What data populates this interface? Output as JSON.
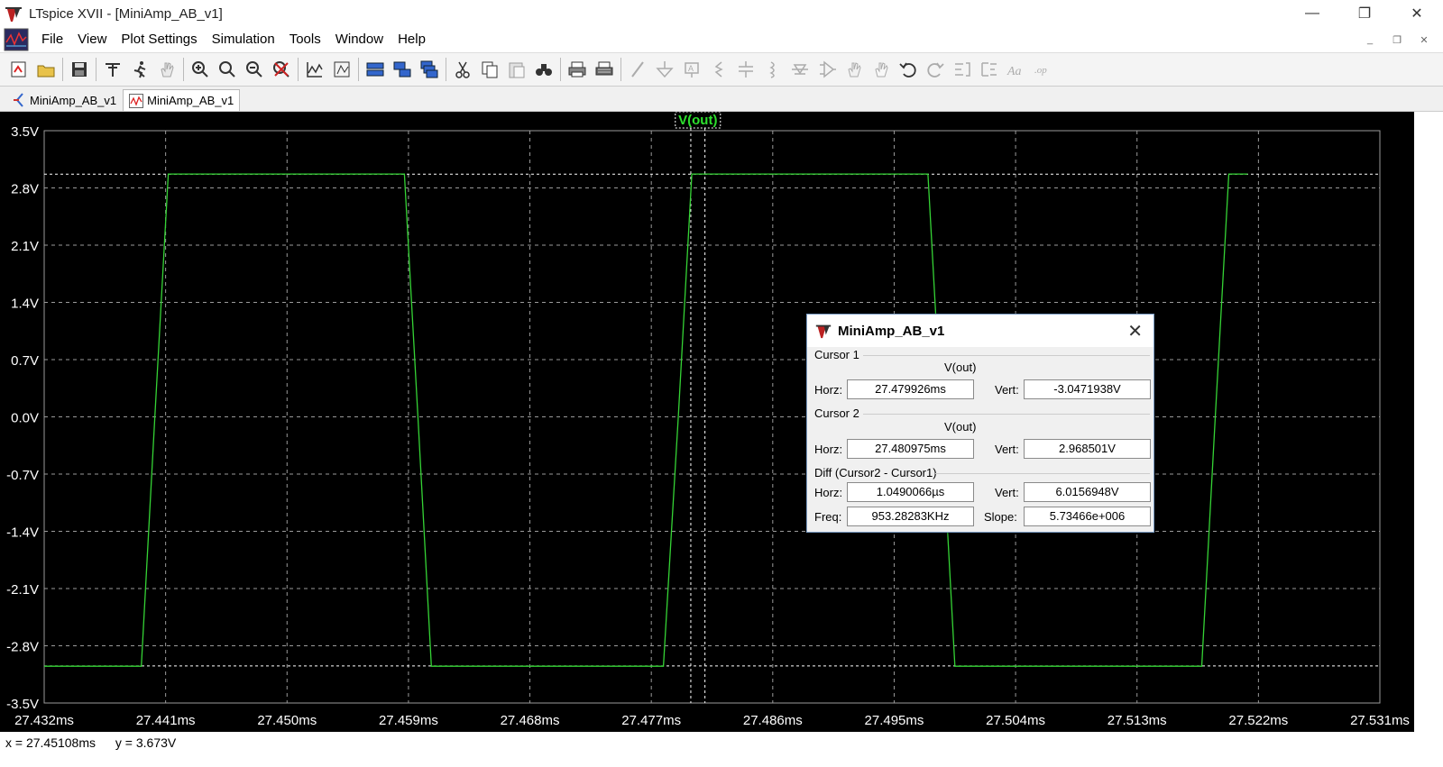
{
  "window": {
    "title": "LTspice XVII - [MiniAmp_AB_v1]",
    "controls": {
      "minimize": "—",
      "restore": "❐",
      "close": "✕"
    }
  },
  "menu": {
    "items": [
      "File",
      "View",
      "Plot Settings",
      "Simulation",
      "Tools",
      "Window",
      "Help"
    ],
    "mdi": {
      "minimize": "_",
      "restore": "❐",
      "close": "✕"
    }
  },
  "toolbar": {
    "icons": [
      "new-schematic-icon",
      "open-icon",
      "save-icon",
      "control-panel-icon",
      "run-icon",
      "pan-icon",
      "zoom-in-icon",
      "zoom-area-icon",
      "zoom-out-icon",
      "zoom-cancel-icon",
      "autorange-icon",
      "mark-unused-icon",
      "tile-vertical-icon",
      "tile-horizontal-icon",
      "cascade-icon",
      "cut-icon",
      "copy-icon",
      "paste-icon",
      "find-icon",
      "print-icon",
      "print-setup-icon",
      "wire-icon",
      "ground-icon",
      "label-icon",
      "resistor-icon",
      "capacitor-icon",
      "inductor-icon",
      "diode-icon",
      "component-icon",
      "move-icon",
      "drag-icon",
      "undo-icon",
      "redo-icon",
      "rotate-icon",
      "mirror-icon",
      "text-icon",
      "spice-directive-icon"
    ]
  },
  "tabs": [
    {
      "label": "MiniAmp_AB_v1",
      "icon": "schematic-icon",
      "active": false
    },
    {
      "label": "MiniAmp_AB_v1",
      "icon": "waveform-icon",
      "active": true
    }
  ],
  "colors": {
    "trace": "#35d335",
    "grid": "#9a9a9a",
    "background": "#000000",
    "axis_text": "#ffffff",
    "trace_label": "#2ee02e"
  },
  "chart_data": {
    "type": "line",
    "title": "",
    "series": [
      {
        "name": "V(out)",
        "x_ms": [
          27.432,
          27.4392,
          27.4402,
          27.4412,
          27.4432,
          27.4587,
          27.4597,
          27.4607,
          27.4627,
          27.4779,
          27.479,
          27.48,
          27.482,
          27.4975,
          27.4985,
          27.4995,
          27.5015,
          27.5178,
          27.5188,
          27.5198,
          27.5212
        ],
        "y_V": [
          -3.05,
          -3.05,
          0.0,
          2.97,
          2.97,
          2.97,
          0.0,
          -3.05,
          -3.05,
          -3.05,
          0.0,
          2.97,
          2.97,
          2.97,
          0.0,
          -3.05,
          -3.05,
          -3.05,
          0.0,
          2.97,
          2.97
        ]
      }
    ],
    "x_ticks": [
      "27.432ms",
      "27.441ms",
      "27.450ms",
      "27.459ms",
      "27.468ms",
      "27.477ms",
      "27.486ms",
      "27.495ms",
      "27.504ms",
      "27.513ms",
      "27.522ms",
      "27.531ms"
    ],
    "y_ticks": [
      "3.5V",
      "2.8V",
      "2.1V",
      "1.4V",
      "0.7V",
      "0.0V",
      "-0.7V",
      "-1.4V",
      "-2.1V",
      "-2.8V",
      "-3.5V"
    ],
    "xlim": [
      27.432,
      27.531
    ],
    "ylim": [
      -3.5,
      3.5
    ],
    "cursor1_x": 27.479926,
    "cursor2_x": 27.480975,
    "cursor1_y": -3.0471938,
    "cursor2_y": 2.968501,
    "grid": true
  },
  "cursor_dialog": {
    "title": "MiniAmp_AB_v1",
    "close": "✕",
    "cursor1": {
      "label": "Cursor 1",
      "trace": "V(out)",
      "horz_label": "Horz:",
      "horz": "27.479926ms",
      "vert_label": "Vert:",
      "vert": "-3.0471938V"
    },
    "cursor2": {
      "label": "Cursor 2",
      "trace": "V(out)",
      "horz_label": "Horz:",
      "horz": "27.480975ms",
      "vert_label": "Vert:",
      "vert": "2.968501V"
    },
    "diff": {
      "label": "Diff (Cursor2 - Cursor1)",
      "horz_label": "Horz:",
      "horz": "1.0490066µs",
      "vert_label": "Vert:",
      "vert": "6.0156948V",
      "freq_label": "Freq:",
      "freq": "953.28283KHz",
      "slope_label": "Slope:",
      "slope": "5.73466e+006"
    }
  },
  "status": {
    "x": "x = 27.45108ms",
    "y": "y = 3.673V"
  }
}
